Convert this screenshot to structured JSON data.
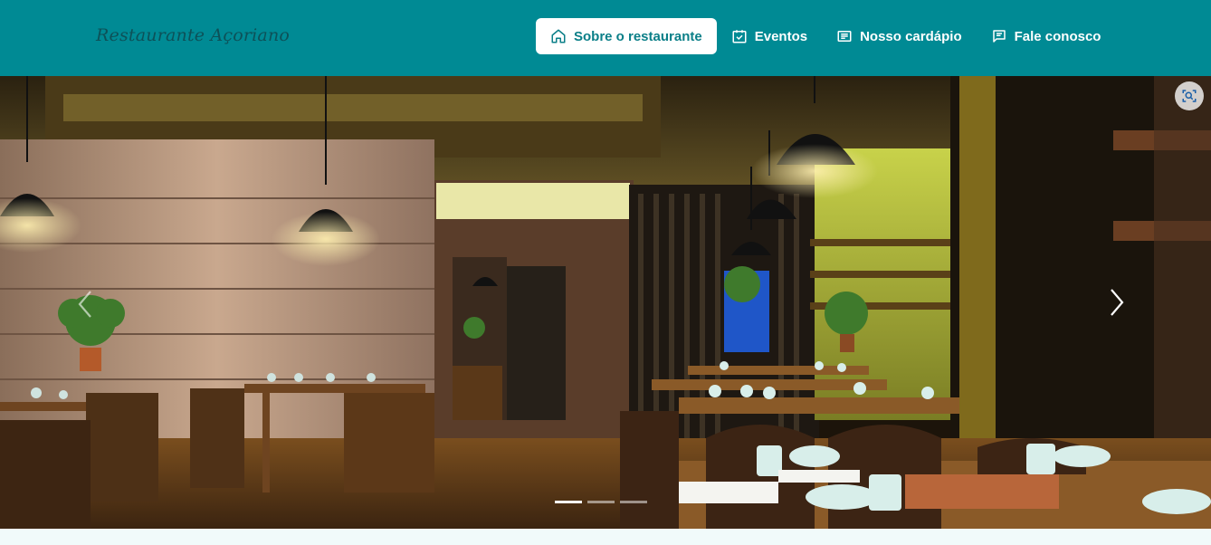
{
  "brand": {
    "name": "Restaurante Açoriano"
  },
  "nav": {
    "items": [
      {
        "label": "Sobre o restaurante",
        "icon": "home-icon",
        "active": true
      },
      {
        "label": "Eventos",
        "icon": "calendar-check-icon",
        "active": false
      },
      {
        "label": "Nosso cardápio",
        "icon": "menu-list-icon",
        "active": false
      },
      {
        "label": "Fale conosco",
        "icon": "message-icon",
        "active": false
      }
    ]
  },
  "carousel": {
    "image_description": "restaurant-interior-photo",
    "slide_count": 3,
    "active_slide": 1,
    "prev_icon": "chevron-left-icon",
    "next_icon": "chevron-right-icon",
    "lens_icon": "visual-search-icon"
  },
  "colors": {
    "navbar": "#008a94",
    "nav_active_text": "#0b7f88",
    "brand_text": "#0d5158",
    "page_background": "#f1fafa"
  }
}
